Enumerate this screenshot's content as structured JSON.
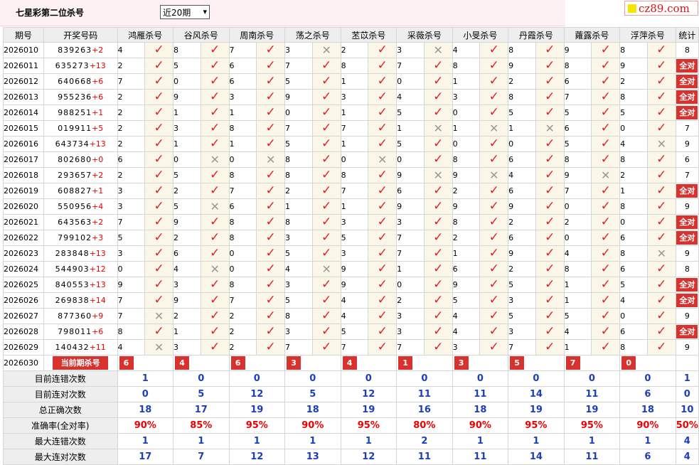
{
  "header": {
    "title": "七星彩第二位杀号",
    "period_select": "近20期",
    "site": "cz89.com"
  },
  "columns": {
    "period": "期号",
    "code": "开奖号码",
    "experts": [
      "鸿雁杀号",
      "谷风杀号",
      "周南杀号",
      "荡之杀号",
      "苤苡杀号",
      "采薇杀号",
      "小旻杀号",
      "丹霞杀号",
      "蕹露杀号",
      "浮萍杀号"
    ],
    "stat": "统计"
  },
  "rows": [
    {
      "period": "2026010",
      "code": "839263",
      "sum": "+2",
      "kills": [
        4,
        8,
        7,
        3,
        2,
        3,
        4,
        8,
        9,
        8
      ],
      "ok": [
        1,
        1,
        1,
        0,
        1,
        0,
        1,
        1,
        1,
        1
      ],
      "stat": "8",
      "all": false
    },
    {
      "period": "2026011",
      "code": "635273",
      "sum": "+13",
      "kills": [
        2,
        5,
        6,
        7,
        8,
        7,
        8,
        9,
        8,
        9
      ],
      "ok": [
        1,
        1,
        1,
        1,
        1,
        1,
        1,
        1,
        1,
        1
      ],
      "stat": "全对",
      "all": true
    },
    {
      "period": "2026012",
      "code": "640668",
      "sum": "+6",
      "kills": [
        7,
        0,
        6,
        5,
        1,
        0,
        1,
        2,
        6,
        2
      ],
      "ok": [
        1,
        1,
        1,
        1,
        1,
        1,
        1,
        1,
        1,
        1
      ],
      "stat": "全对",
      "all": true
    },
    {
      "period": "2026013",
      "code": "955236",
      "sum": "+6",
      "kills": [
        2,
        9,
        3,
        9,
        3,
        4,
        3,
        8,
        7,
        8
      ],
      "ok": [
        1,
        1,
        1,
        1,
        1,
        1,
        1,
        1,
        1,
        1
      ],
      "stat": "全对",
      "all": true
    },
    {
      "period": "2026014",
      "code": "988251",
      "sum": "+1",
      "kills": [
        2,
        1,
        1,
        0,
        1,
        5,
        0,
        5,
        5,
        5
      ],
      "ok": [
        1,
        1,
        1,
        1,
        1,
        1,
        1,
        1,
        1,
        1
      ],
      "stat": "全对",
      "all": true
    },
    {
      "period": "2026015",
      "code": "019911",
      "sum": "+5",
      "kills": [
        2,
        3,
        8,
        7,
        7,
        1,
        1,
        1,
        6,
        0
      ],
      "ok": [
        1,
        1,
        1,
        1,
        1,
        0,
        0,
        0,
        1,
        1
      ],
      "stat": "7",
      "all": false
    },
    {
      "period": "2026016",
      "code": "643734",
      "sum": "+13",
      "kills": [
        2,
        1,
        1,
        5,
        1,
        5,
        0,
        0,
        5,
        4
      ],
      "ok": [
        1,
        1,
        1,
        1,
        1,
        1,
        1,
        1,
        1,
        0
      ],
      "stat": "9",
      "all": false
    },
    {
      "period": "2026017",
      "code": "802680",
      "sum": "+0",
      "kills": [
        6,
        0,
        0,
        8,
        0,
        0,
        8,
        6,
        8,
        8
      ],
      "ok": [
        1,
        0,
        0,
        1,
        0,
        1,
        1,
        1,
        1,
        1
      ],
      "stat": "6",
      "all": false
    },
    {
      "period": "2026018",
      "code": "293657",
      "sum": "+2",
      "kills": [
        2,
        5,
        8,
        8,
        8,
        9,
        9,
        4,
        9,
        2
      ],
      "ok": [
        1,
        1,
        1,
        1,
        1,
        0,
        0,
        1,
        0,
        1
      ],
      "stat": "7",
      "all": false
    },
    {
      "period": "2026019",
      "code": "608827",
      "sum": "+1",
      "kills": [
        3,
        2,
        7,
        2,
        7,
        6,
        2,
        6,
        7,
        1
      ],
      "ok": [
        1,
        1,
        1,
        1,
        1,
        1,
        1,
        1,
        1,
        1
      ],
      "stat": "全对",
      "all": true
    },
    {
      "period": "2026020",
      "code": "550956",
      "sum": "+4",
      "kills": [
        3,
        5,
        6,
        1,
        1,
        9,
        9,
        9,
        0,
        8
      ],
      "ok": [
        1,
        0,
        1,
        1,
        1,
        1,
        1,
        1,
        1,
        1
      ],
      "stat": "9",
      "all": false
    },
    {
      "period": "2026021",
      "code": "643563",
      "sum": "+2",
      "kills": [
        7,
        9,
        8,
        8,
        3,
        3,
        8,
        2,
        2,
        0
      ],
      "ok": [
        1,
        1,
        1,
        1,
        1,
        1,
        1,
        1,
        1,
        1
      ],
      "stat": "全对",
      "all": true
    },
    {
      "period": "2026022",
      "code": "799102",
      "sum": "+3",
      "kills": [
        5,
        2,
        8,
        3,
        5,
        7,
        2,
        6,
        0,
        6
      ],
      "ok": [
        1,
        1,
        1,
        1,
        1,
        1,
        1,
        1,
        1,
        1
      ],
      "stat": "全对",
      "all": true
    },
    {
      "period": "2026023",
      "code": "283848",
      "sum": "+13",
      "kills": [
        3,
        6,
        0,
        5,
        3,
        7,
        1,
        9,
        4,
        8
      ],
      "ok": [
        1,
        1,
        1,
        1,
        1,
        1,
        1,
        1,
        1,
        0
      ],
      "stat": "9",
      "all": false
    },
    {
      "period": "2026024",
      "code": "544903",
      "sum": "+12",
      "kills": [
        0,
        4,
        0,
        4,
        9,
        1,
        6,
        2,
        8,
        6
      ],
      "ok": [
        1,
        0,
        1,
        0,
        1,
        1,
        1,
        1,
        1,
        1
      ],
      "stat": "8",
      "all": false
    },
    {
      "period": "2026025",
      "code": "840553",
      "sum": "+13",
      "kills": [
        9,
        3,
        8,
        3,
        9,
        0,
        9,
        5,
        1,
        5
      ],
      "ok": [
        1,
        1,
        1,
        1,
        1,
        1,
        1,
        1,
        1,
        1
      ],
      "stat": "全对",
      "all": true
    },
    {
      "period": "2026026",
      "code": "269838",
      "sum": "+14",
      "kills": [
        7,
        9,
        7,
        5,
        4,
        2,
        5,
        3,
        1,
        4
      ],
      "ok": [
        1,
        1,
        1,
        1,
        1,
        1,
        1,
        1,
        1,
        1
      ],
      "stat": "全对",
      "all": true
    },
    {
      "period": "2026027",
      "code": "877360",
      "sum": "+9",
      "kills": [
        7,
        2,
        2,
        8,
        4,
        3,
        4,
        5,
        5,
        0
      ],
      "ok": [
        0,
        1,
        1,
        1,
        1,
        1,
        1,
        1,
        1,
        1
      ],
      "stat": "9",
      "all": false
    },
    {
      "period": "2026028",
      "code": "798011",
      "sum": "+6",
      "kills": [
        8,
        1,
        2,
        3,
        5,
        3,
        4,
        3,
        4,
        6
      ],
      "ok": [
        1,
        1,
        1,
        1,
        1,
        1,
        1,
        1,
        1,
        1
      ],
      "stat": "全对",
      "all": true
    },
    {
      "period": "2026029",
      "code": "140432",
      "sum": "+11",
      "kills": [
        4,
        3,
        2,
        7,
        7,
        7,
        3,
        7,
        1,
        8
      ],
      "ok": [
        0,
        1,
        1,
        1,
        1,
        1,
        1,
        1,
        1,
        1
      ],
      "stat": "9",
      "all": false
    }
  ],
  "current": {
    "period": "2026030",
    "label": "当前期杀号",
    "kills": [
      "6",
      "4",
      "6",
      "3",
      "4",
      "1",
      "3",
      "5",
      "7",
      "0"
    ]
  },
  "summary": [
    {
      "label": "目前连错次数",
      "values": [
        "1",
        "0",
        "0",
        "0",
        "0",
        "0",
        "0",
        "0",
        "0",
        "0",
        "1"
      ],
      "red": false
    },
    {
      "label": "目前连对次数",
      "values": [
        "0",
        "5",
        "12",
        "5",
        "12",
        "11",
        "11",
        "14",
        "11",
        "6",
        "0"
      ],
      "red": false
    },
    {
      "label": "总正确次数",
      "values": [
        "18",
        "17",
        "19",
        "18",
        "19",
        "16",
        "18",
        "19",
        "19",
        "18",
        "10"
      ],
      "red": false
    },
    {
      "label": "准确率(全对率)",
      "values": [
        "90%",
        "85%",
        "95%",
        "90%",
        "95%",
        "80%",
        "90%",
        "95%",
        "95%",
        "90%",
        "50%"
      ],
      "red": true
    },
    {
      "label": "最大连错次数",
      "values": [
        "1",
        "1",
        "1",
        "1",
        "1",
        "2",
        "1",
        "1",
        "1",
        "1",
        "4"
      ],
      "red": false
    },
    {
      "label": "最大连对次数",
      "values": [
        "17",
        "7",
        "12",
        "13",
        "12",
        "11",
        "11",
        "14",
        "11",
        "6",
        "4"
      ],
      "red": false
    }
  ],
  "glyphs": {
    "ok": "✓",
    "no": "✕"
  },
  "colors": {
    "accent": "#d8322f",
    "value_blue": "#1a3fb8",
    "mark_bg": "#fbf7e8",
    "header_bg": "#eeeeee"
  }
}
